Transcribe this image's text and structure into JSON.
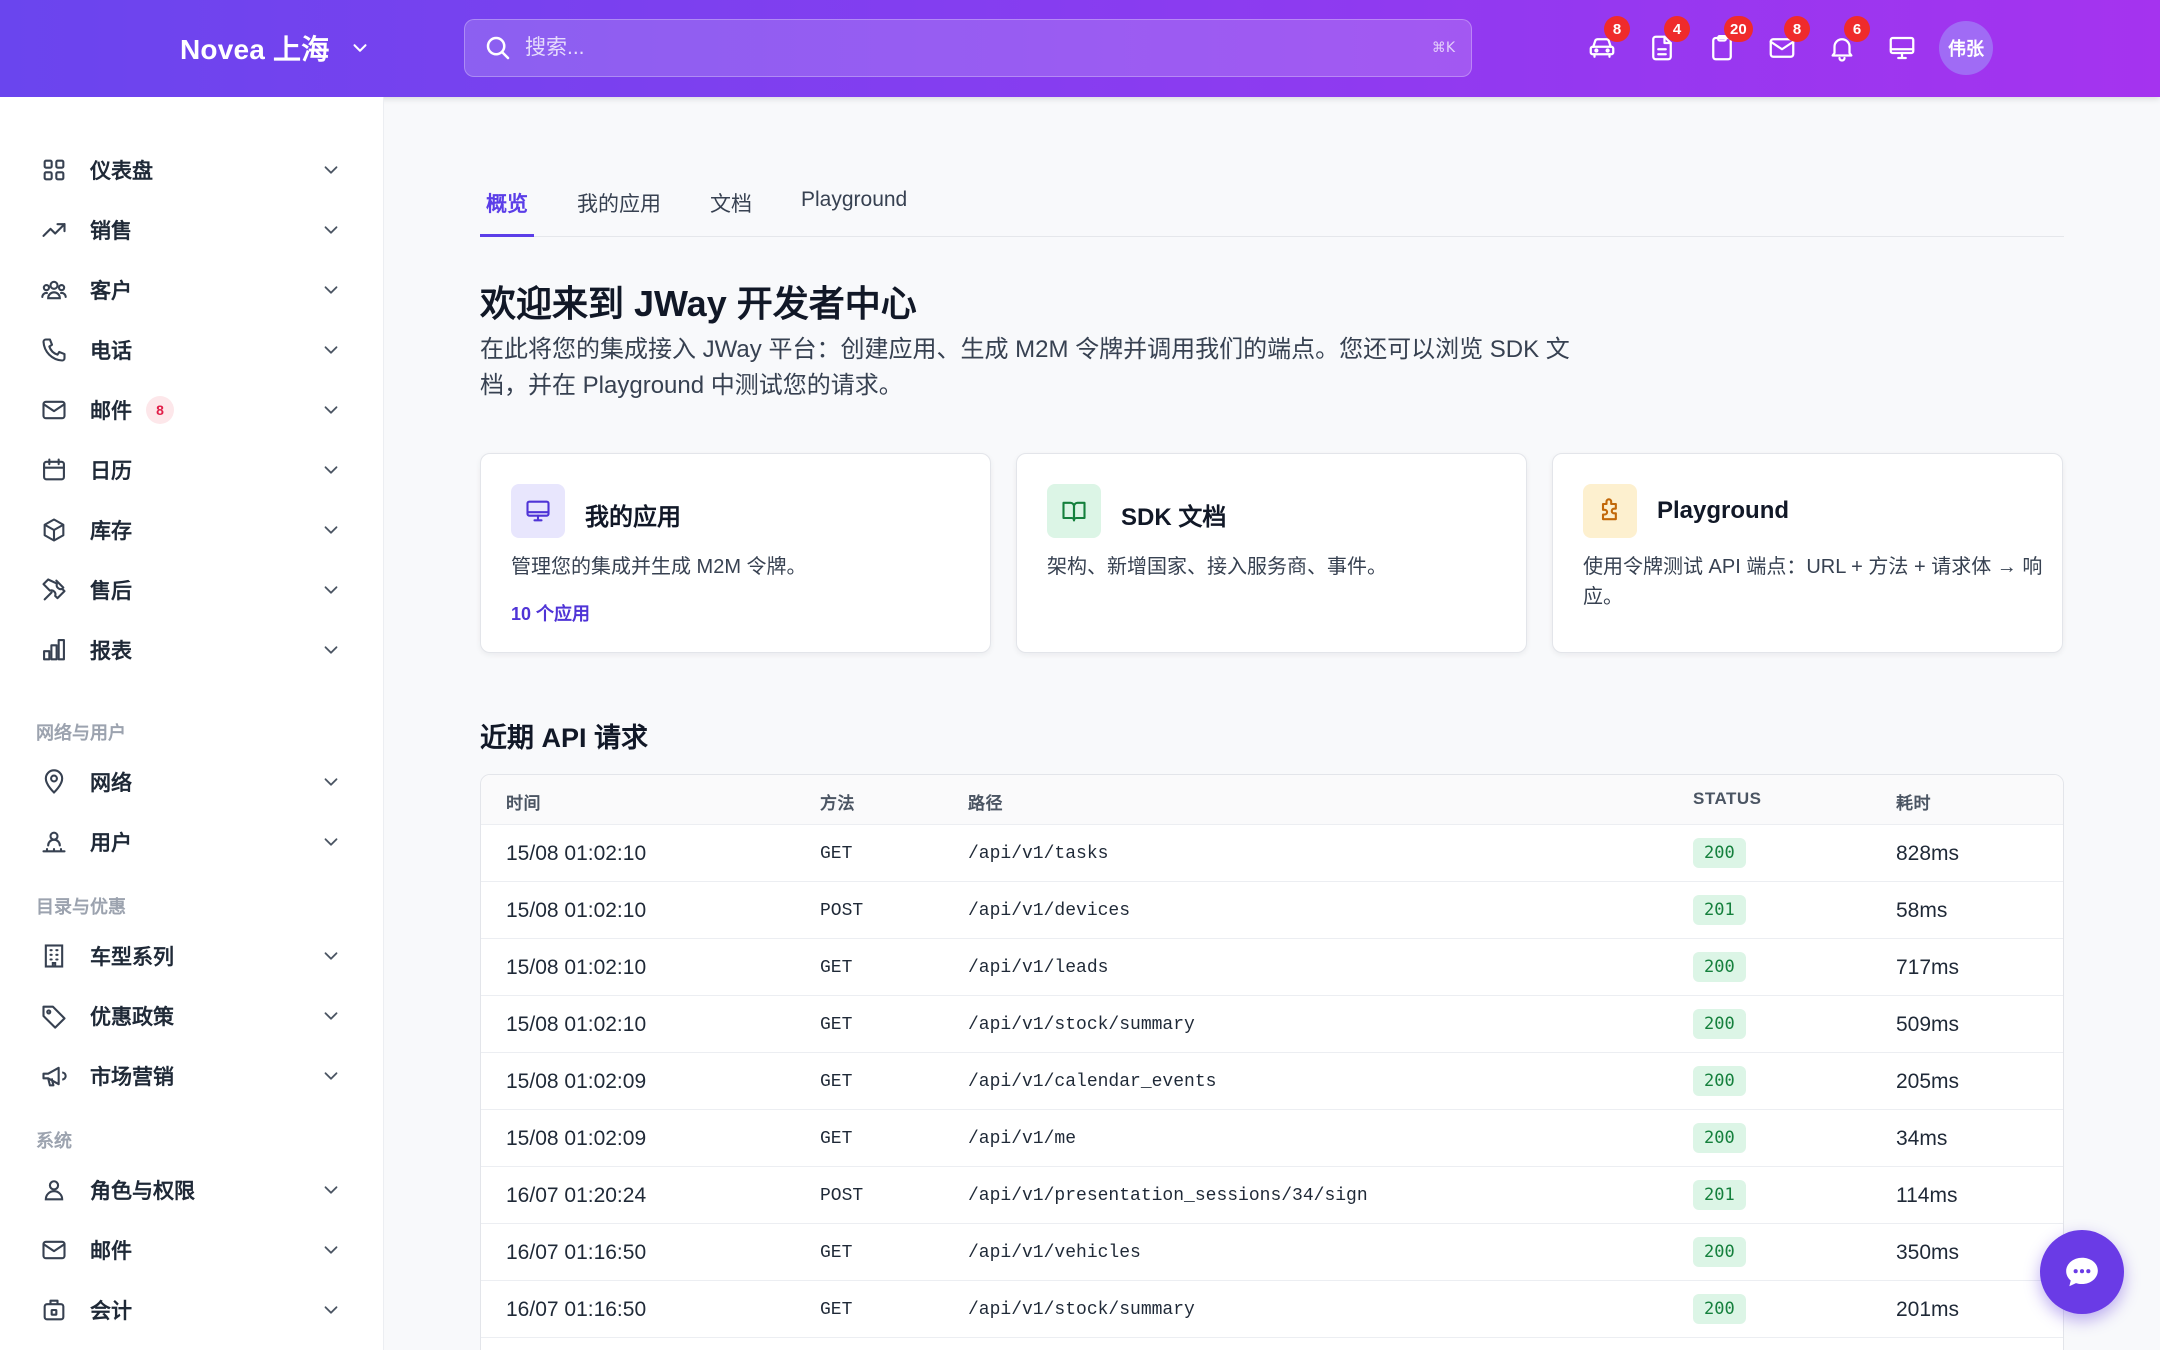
{
  "header": {
    "brand": "Novea 上海",
    "search_placeholder": "搜索...",
    "search_shortcut": "⌘K",
    "icons": [
      {
        "name": "car-icon",
        "badge": "8"
      },
      {
        "name": "document-icon",
        "badge": "4"
      },
      {
        "name": "clipboard-icon",
        "badge": "20"
      },
      {
        "name": "mail-icon",
        "badge": "8"
      },
      {
        "name": "bell-icon",
        "badge": "6"
      },
      {
        "name": "monitor-icon",
        "badge": ""
      }
    ],
    "avatar": "伟张"
  },
  "sidebar": {
    "items": [
      {
        "label": "仪表盘",
        "icon": "grid-icon"
      },
      {
        "label": "销售",
        "icon": "trending-up-icon"
      },
      {
        "label": "客户",
        "icon": "users-icon"
      },
      {
        "label": "电话",
        "icon": "phone-icon"
      },
      {
        "label": "邮件",
        "icon": "mail-icon",
        "badge": "8"
      },
      {
        "label": "日历",
        "icon": "calendar-icon"
      },
      {
        "label": "库存",
        "icon": "box-icon"
      },
      {
        "label": "售后",
        "icon": "tools-icon"
      },
      {
        "label": "报表",
        "icon": "bar-chart-icon"
      }
    ],
    "sections": [
      {
        "label": "网络与用户",
        "items": [
          {
            "label": "网络",
            "icon": "map-pin-icon"
          },
          {
            "label": "用户",
            "icon": "user-network-icon"
          }
        ]
      },
      {
        "label": "目录与优惠",
        "items": [
          {
            "label": "车型系列",
            "icon": "building-icon"
          },
          {
            "label": "优惠政策",
            "icon": "tag-icon"
          },
          {
            "label": "市场营销",
            "icon": "megaphone-icon"
          }
        ]
      },
      {
        "label": "系统",
        "items": [
          {
            "label": "角色与权限",
            "icon": "user-icon"
          },
          {
            "label": "邮件",
            "icon": "mail-icon"
          },
          {
            "label": "会计",
            "icon": "briefcase-lock-icon"
          }
        ]
      }
    ]
  },
  "tabs": [
    "概览",
    "我的应用",
    "文档",
    "Playground"
  ],
  "main": {
    "title": "欢迎来到 JWay 开发者中心",
    "subtitle": "在此将您的集成接入 JWay 平台：创建应用、生成 M2M 令牌并调用我们的端点。您还可以浏览 SDK 文档，并在 Playground 中测试您的请求。",
    "cards": [
      {
        "title": "我的应用",
        "desc": "管理您的集成并生成 M2M 令牌。",
        "link": "10 个应用",
        "icon": "monitor-icon",
        "color": "#e8e6fd"
      },
      {
        "title": "SDK 文档",
        "desc": "架构、新增国家、接入服务商、事件。",
        "link": "",
        "icon": "book-icon",
        "color": "#dcf5e6"
      },
      {
        "title": "Playground",
        "desc": "使用令牌测试 API 端点：URL + 方法 + 请求体 → 响应。",
        "link": "",
        "icon": "puzzle-icon",
        "color": "#fdf0cf"
      }
    ],
    "recent_title": "近期 API 请求"
  },
  "table": {
    "headers": [
      "时间",
      "方法",
      "路径",
      "STATUS",
      "耗时"
    ],
    "rows": [
      [
        "15/08 01:02:10",
        "GET",
        "/api/v1/tasks",
        "200",
        "828ms"
      ],
      [
        "15/08 01:02:10",
        "POST",
        "/api/v1/devices",
        "201",
        "58ms"
      ],
      [
        "15/08 01:02:10",
        "GET",
        "/api/v1/leads",
        "200",
        "717ms"
      ],
      [
        "15/08 01:02:10",
        "GET",
        "/api/v1/stock/summary",
        "200",
        "509ms"
      ],
      [
        "15/08 01:02:09",
        "GET",
        "/api/v1/calendar_events",
        "200",
        "205ms"
      ],
      [
        "15/08 01:02:09",
        "GET",
        "/api/v1/me",
        "200",
        "34ms"
      ],
      [
        "16/07 01:20:24",
        "POST",
        "/api/v1/presentation_sessions/34/sign",
        "201",
        "114ms"
      ],
      [
        "16/07 01:16:50",
        "GET",
        "/api/v1/vehicles",
        "200",
        "350ms"
      ],
      [
        "16/07 01:16:50",
        "GET",
        "/api/v1/stock/summary",
        "200",
        "201ms"
      ]
    ]
  },
  "colors": {
    "accent": "#5b3ee8",
    "header_start": "#6a45ee",
    "header_end": "#a533ef",
    "badge": "#ef2b2b",
    "status_ok": "#15803d"
  }
}
